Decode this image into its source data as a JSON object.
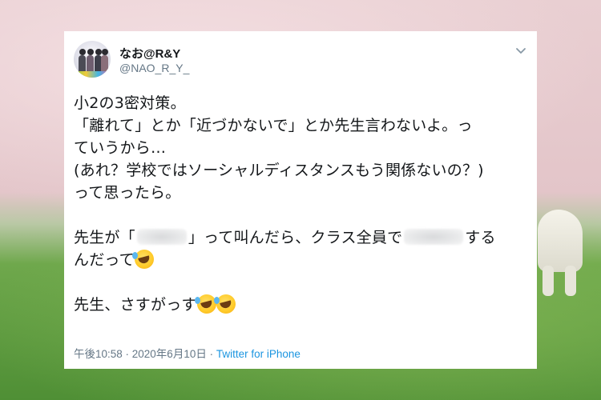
{
  "tweet": {
    "display_name": "なお@R&Y",
    "screen_name": "@NAO_R_Y_",
    "lines": {
      "l1": "小2の3密対策。",
      "l2": "「離れて」とか「近づかないで」とか先生言わないよ。っ",
      "l3": "ていうから…",
      "l4": "(あれ？学校ではソーシャルディスタンスもう関係ないの？)",
      "l5": "って思ったら。",
      "l6a": "先生が「",
      "l6b": "」って叫んだら、クラス全員で",
      "l6c": "する",
      "l7": "んだって",
      "l8": "先生、さすがっす"
    },
    "timestamp": "午後10:58 · 2020年6月10日",
    "separator": " · ",
    "source": "Twitter for iPhone"
  },
  "icons": {
    "caret": "chevron-down-icon",
    "emoji": "rolling-on-the-floor-laughing-emoji",
    "avatar": "profile-avatar"
  },
  "colors": {
    "name": "#14171a",
    "handle": "#657786",
    "link": "#1b95e0"
  }
}
